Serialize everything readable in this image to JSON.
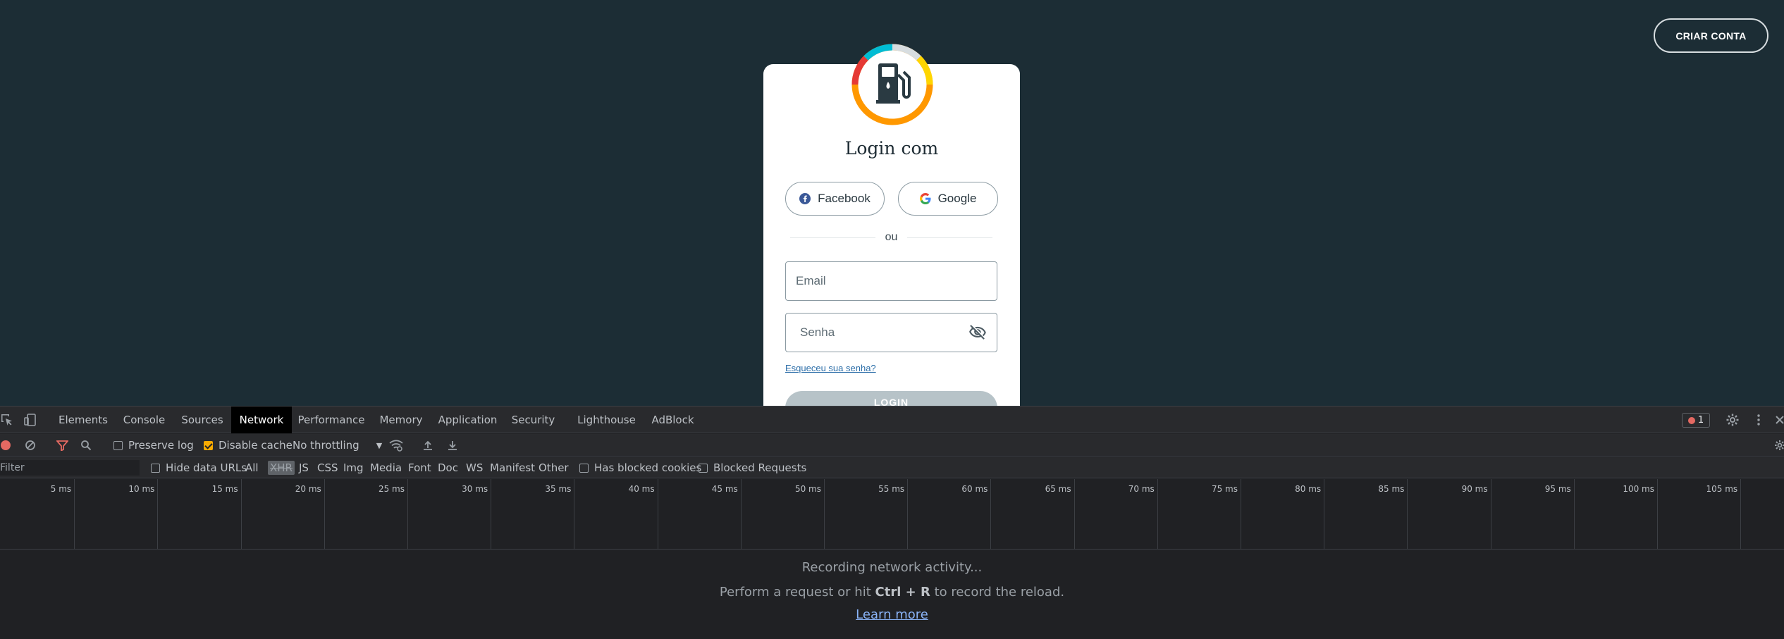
{
  "page": {
    "criar_conta": "CRIAR CONTA",
    "title": "Login com",
    "social": {
      "facebook": "Facebook",
      "google": "Google"
    },
    "divider_text": "ou",
    "email_placeholder": "Email",
    "senha_placeholder": "Senha",
    "forgot": "Esqueceu sua senha?",
    "login_button": "LOGIN",
    "colors": {
      "background": "#1c2d35",
      "card": "#ffffff",
      "accent_orange": "#ff9800",
      "accent_yellow": "#ffd600",
      "accent_red": "#e53935",
      "accent_cyan": "#00bcd4"
    },
    "icons": [
      "fuel-pump-logo-icon",
      "facebook-icon",
      "google-icon",
      "eye-off-icon"
    ]
  },
  "devtools": {
    "tabs": [
      "Elements",
      "Console",
      "Sources",
      "Network",
      "Performance",
      "Memory",
      "Application",
      "Security",
      "Lighthouse",
      "AdBlock"
    ],
    "active_tab": "Network",
    "error_count": "1",
    "toolbar": {
      "preserve_log": "Preserve log",
      "disable_cache": "Disable cache",
      "throttling": "No throttling"
    },
    "filter": {
      "placeholder": "Filter",
      "hide_data_urls": "Hide data URLs",
      "types": [
        "All",
        "XHR",
        "JS",
        "CSS",
        "Img",
        "Media",
        "Font",
        "Doc",
        "WS",
        "Manifest",
        "Other"
      ],
      "has_blocked_cookies": "Has blocked cookies",
      "blocked_requests": "Blocked Requests"
    },
    "timeline_ticks": [
      "5 ms",
      "10 ms",
      "15 ms",
      "20 ms",
      "25 ms",
      "30 ms",
      "35 ms",
      "40 ms",
      "45 ms",
      "50 ms",
      "55 ms",
      "60 ms",
      "65 ms",
      "70 ms",
      "75 ms",
      "80 ms",
      "85 ms",
      "90 ms",
      "95 ms",
      "100 ms",
      "105 ms"
    ],
    "empty": {
      "recording": "Recording network activity...",
      "perform_prefix": "Perform a request or hit ",
      "shortcut": "Ctrl + R",
      "perform_suffix": " to record the reload.",
      "learn_more": "Learn more"
    }
  }
}
